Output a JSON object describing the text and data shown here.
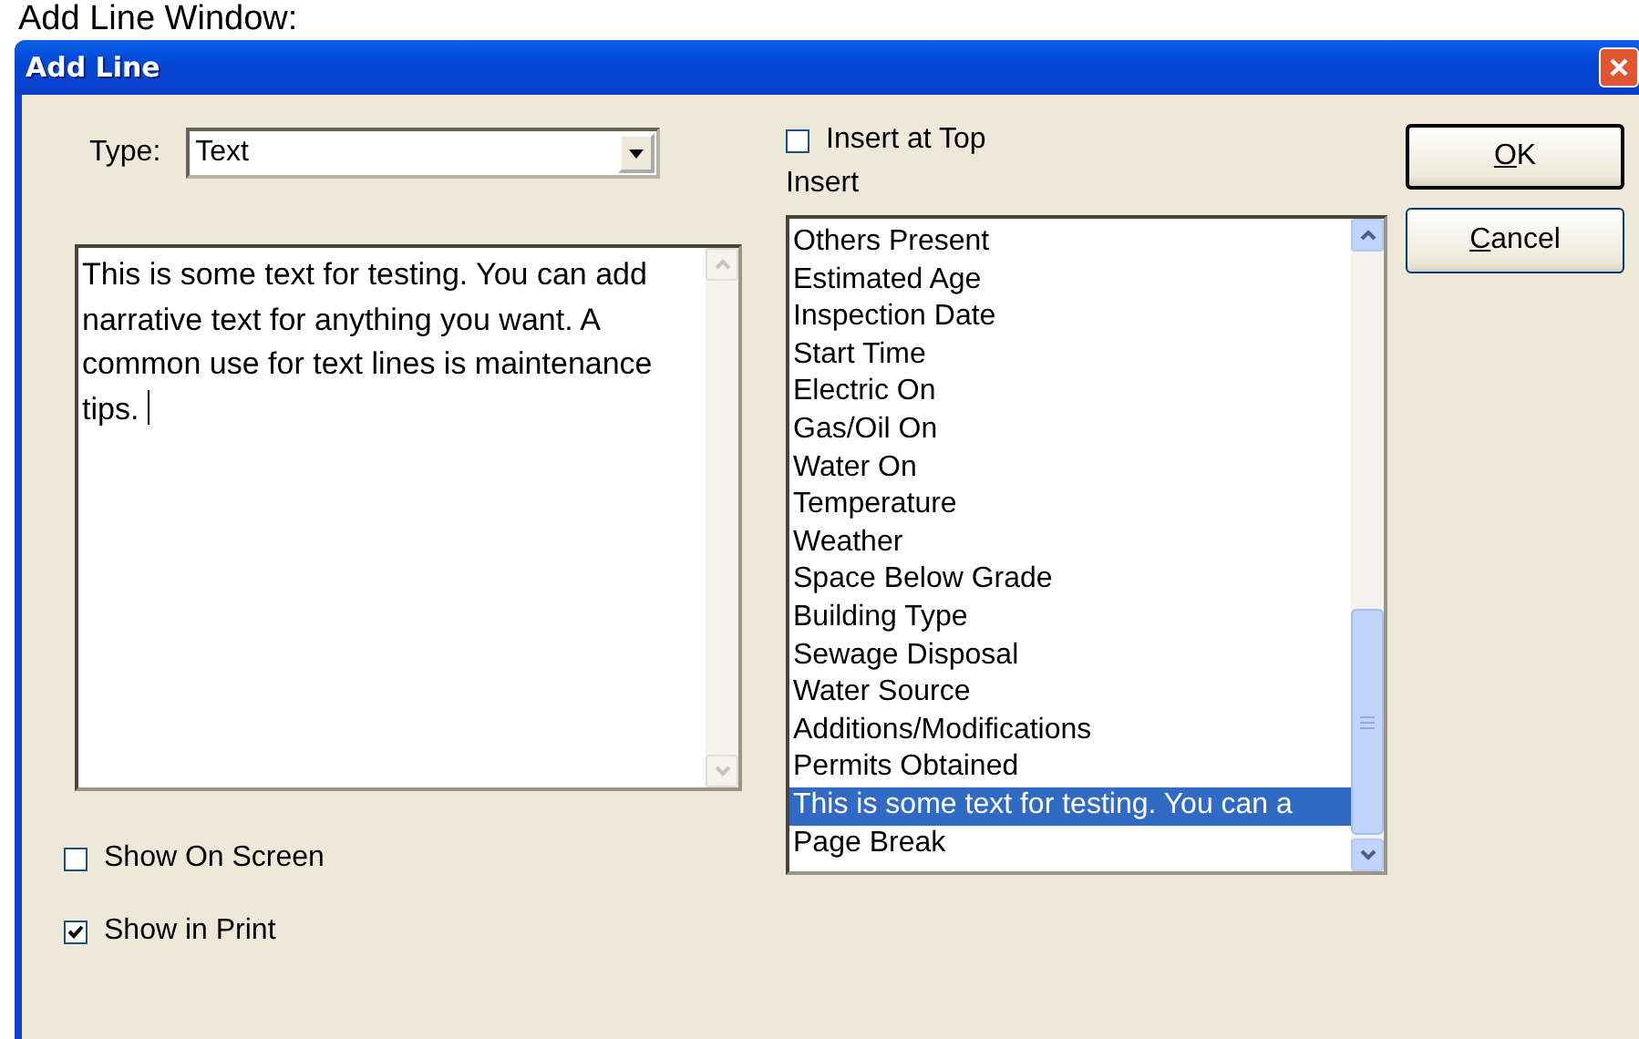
{
  "caption": "Add Line Window:",
  "window": {
    "title": "Add Line"
  },
  "type_field": {
    "label": "Type:",
    "value": "Text"
  },
  "text_area": {
    "value": "This is some text for testing. You can add narrative text for anything you want. A common use for text lines is maintenance tips. "
  },
  "insert_at_top": {
    "label": "Insert at Top",
    "checked": false
  },
  "insert_label": "Insert",
  "insert_list": [
    {
      "label": "Others Present",
      "selected": false
    },
    {
      "label": "Estimated Age",
      "selected": false
    },
    {
      "label": "Inspection Date",
      "selected": false
    },
    {
      "label": "Start Time",
      "selected": false
    },
    {
      "label": "Electric On",
      "selected": false
    },
    {
      "label": "Gas/Oil On",
      "selected": false
    },
    {
      "label": "Water On",
      "selected": false
    },
    {
      "label": "Temperature",
      "selected": false
    },
    {
      "label": "Weather",
      "selected": false
    },
    {
      "label": "Space Below Grade",
      "selected": false
    },
    {
      "label": "Building Type",
      "selected": false
    },
    {
      "label": "Sewage Disposal",
      "selected": false
    },
    {
      "label": "Water Source",
      "selected": false
    },
    {
      "label": "Additions/Modifications",
      "selected": false
    },
    {
      "label": "Permits Obtained",
      "selected": false
    },
    {
      "label": "This is some text for testing. You can a",
      "selected": true
    },
    {
      "label": "Page Break",
      "selected": false
    }
  ],
  "options": [
    {
      "label": "Show On Screen",
      "checked": false
    },
    {
      "label": "Show in Print",
      "checked": true
    }
  ],
  "buttons": [
    {
      "mnemonic": "O",
      "rest": "K",
      "default": true
    },
    {
      "mnemonic": "C",
      "rest": "ancel",
      "default": false
    }
  ]
}
